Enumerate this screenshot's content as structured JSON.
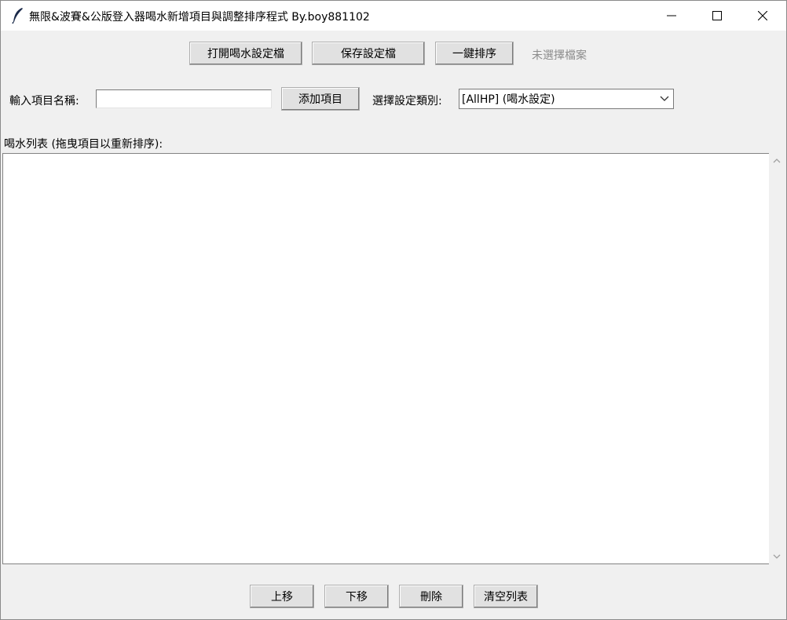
{
  "window": {
    "title": "無限&波賽&公版登入器喝水新增項目與調整排序程式 By.boy881102"
  },
  "toolbar": {
    "open_label": "打開喝水設定檔",
    "save_label": "保存設定檔",
    "sort_label": "一鍵排序",
    "file_status": "未選擇檔案"
  },
  "input_row": {
    "item_name_label": "輸入項目名稱:",
    "item_name_value": "",
    "add_label": "添加項目",
    "category_label": "選擇設定類別:",
    "category_selected": "[AllHP] (喝水設定)"
  },
  "list": {
    "header": "喝水列表 (拖曳項目以重新排序):",
    "items": []
  },
  "bottom": {
    "up_label": "上移",
    "down_label": "下移",
    "delete_label": "刪除",
    "clear_label": "清空列表"
  },
  "icons": {
    "app": "feather-icon",
    "minimize": "minimize-icon",
    "maximize": "maximize-icon",
    "close": "close-icon",
    "dropdown": "chevron-down-icon",
    "scroll_up": "chevron-up-icon",
    "scroll_down": "chevron-down-icon"
  }
}
